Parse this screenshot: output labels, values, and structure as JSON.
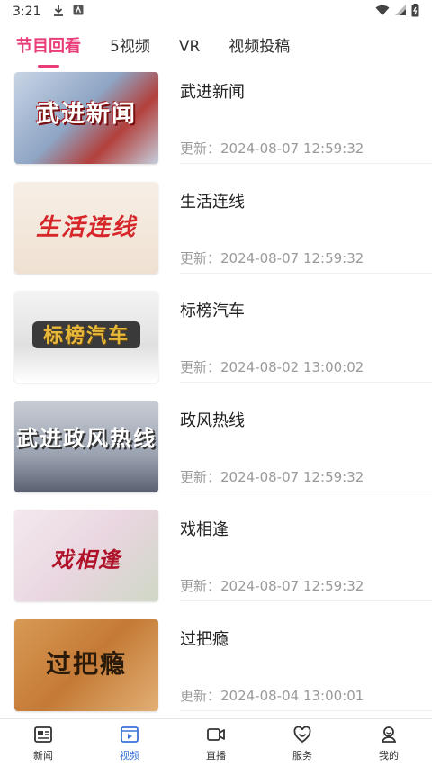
{
  "status_bar": {
    "time": "3:21"
  },
  "tabs": [
    {
      "label": "节目回看",
      "active": true
    },
    {
      "label": "5视频",
      "active": false
    },
    {
      "label": "VR",
      "active": false
    },
    {
      "label": "视频投稿",
      "active": false
    }
  ],
  "items": [
    {
      "title": "武进新闻",
      "update": "更新：2024-08-07 12:59:32",
      "thumb_text": "武进新闻"
    },
    {
      "title": "生活连线",
      "update": "更新：2024-08-07 12:59:32",
      "thumb_text": "生活连线"
    },
    {
      "title": "标榜汽车",
      "update": "更新：2024-08-02 13:00:02",
      "thumb_text": "标榜汽车"
    },
    {
      "title": "政风热线",
      "update": "更新：2024-08-07 12:59:32",
      "thumb_text": "武进政风热线"
    },
    {
      "title": "戏相逢",
      "update": "更新：2024-08-07 12:59:32",
      "thumb_text": "戏相逢"
    },
    {
      "title": "过把瘾",
      "update": "更新：2024-08-04 13:00:01",
      "thumb_text": "过把瘾"
    }
  ],
  "bottom_nav": [
    {
      "label": "新闻",
      "icon": "news-icon",
      "active": false
    },
    {
      "label": "视频",
      "icon": "video-icon",
      "active": true
    },
    {
      "label": "直播",
      "icon": "live-icon",
      "active": false
    },
    {
      "label": "服务",
      "icon": "service-icon",
      "active": false
    },
    {
      "label": "我的",
      "icon": "profile-icon",
      "active": false
    }
  ],
  "colors": {
    "accent": "#e83d79",
    "nav_active": "#3a73d9",
    "meta_text": "#9a9a9a"
  }
}
